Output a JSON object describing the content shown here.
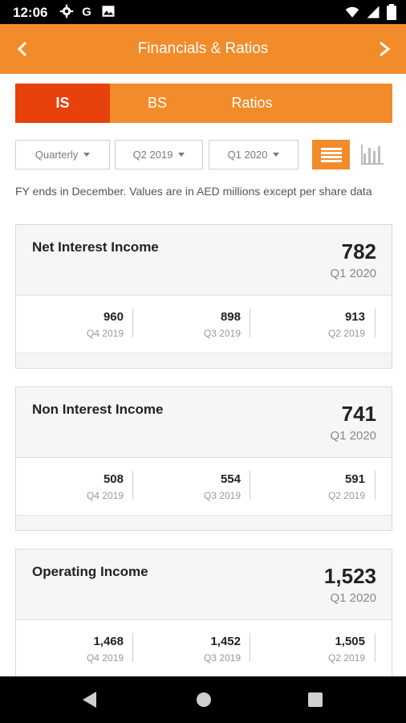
{
  "status_bar": {
    "time": "12:06"
  },
  "app_bar": {
    "title": "Financials & Ratios"
  },
  "tabs": [
    {
      "label": "IS",
      "active": true
    },
    {
      "label": "BS",
      "active": false
    },
    {
      "label": "Ratios",
      "active": false
    }
  ],
  "filters": {
    "frequency": "Quarterly",
    "from": "Q2 2019",
    "to": "Q1 2020"
  },
  "note": "FY ends in December. Values are in AED millions except per share data",
  "cards": [
    {
      "title": "Net Interest Income",
      "value": "782",
      "period": "Q1 2020",
      "history": [
        {
          "value": "960",
          "period": "Q4 2019"
        },
        {
          "value": "898",
          "period": "Q3 2019"
        },
        {
          "value": "913",
          "period": "Q2 2019"
        }
      ]
    },
    {
      "title": "Non Interest Income",
      "value": "741",
      "period": "Q1 2020",
      "history": [
        {
          "value": "508",
          "period": "Q4 2019"
        },
        {
          "value": "554",
          "period": "Q3 2019"
        },
        {
          "value": "591",
          "period": "Q2 2019"
        }
      ]
    },
    {
      "title": "Operating Income",
      "value": "1,523",
      "period": "Q1 2020",
      "history": [
        {
          "value": "1,468",
          "period": "Q4 2019"
        },
        {
          "value": "1,452",
          "period": "Q3 2019"
        },
        {
          "value": "1,505",
          "period": "Q2 2019"
        }
      ]
    }
  ],
  "colors": {
    "accent": "#F28C2B",
    "active_tab": "#E8410C"
  },
  "icons": [
    "settings-icon",
    "google-icon",
    "gallery-icon",
    "wifi-icon",
    "signal-icon",
    "battery-icon",
    "back-arrow-icon",
    "forward-arrow-icon",
    "list-view-icon",
    "bar-chart-icon"
  ]
}
